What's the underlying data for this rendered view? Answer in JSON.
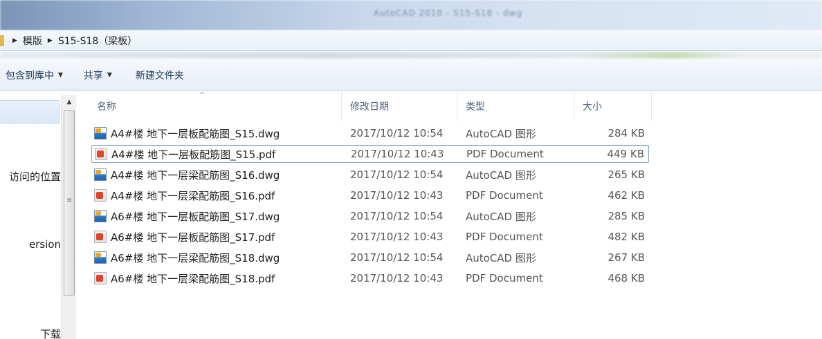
{
  "window": {
    "title_blurred": "AutoCAD 2010 - S15-S18 - dwg"
  },
  "address": {
    "crumbs": [
      "模版",
      "S15-S18（梁板）"
    ]
  },
  "toolbar": {
    "include_label": "包含到库中",
    "share_label": "共享",
    "new_folder_label": "新建文件夹"
  },
  "nav": {
    "items": [
      "访问的位置",
      "ersion",
      "下载"
    ]
  },
  "columns": {
    "name": "名称",
    "date": "修改日期",
    "type": "类型",
    "size": "大小"
  },
  "files": [
    {
      "name": "A4#楼 地下一层板配筋图_S15.dwg",
      "date": "2017/10/12 10:54",
      "type": "AutoCAD 图形",
      "size": "284 KB",
      "icon": "dwg-file-icon"
    },
    {
      "name": "A4#楼 地下一层板配筋图_S15.pdf",
      "date": "2017/10/12 10:43",
      "type": "PDF Document",
      "size": "449 KB",
      "icon": "pdf-file-icon"
    },
    {
      "name": "A4#楼 地下一层梁配筋图_S16.dwg",
      "date": "2017/10/12 10:54",
      "type": "AutoCAD 图形",
      "size": "265 KB",
      "icon": "dwg-file-icon"
    },
    {
      "name": "A4#楼 地下一层梁配筋图_S16.pdf",
      "date": "2017/10/12 10:43",
      "type": "PDF Document",
      "size": "462 KB",
      "icon": "pdf-file-icon"
    },
    {
      "name": "A6#楼 地下一层板配筋图_S17.dwg",
      "date": "2017/10/12 10:54",
      "type": "AutoCAD 图形",
      "size": "285 KB",
      "icon": "dwg-file-icon"
    },
    {
      "name": "A6#楼 地下一层板配筋图_S17.pdf",
      "date": "2017/10/12 10:43",
      "type": "PDF Document",
      "size": "482 KB",
      "icon": "pdf-file-icon"
    },
    {
      "name": "A6#楼 地下一层梁配筋图_S18.dwg",
      "date": "2017/10/12 10:54",
      "type": "AutoCAD 图形",
      "size": "267 KB",
      "icon": "dwg-file-icon"
    },
    {
      "name": "A6#楼 地下一层梁配筋图_S18.pdf",
      "date": "2017/10/12 10:43",
      "type": "PDF Document",
      "size": "468 KB",
      "icon": "pdf-file-icon"
    }
  ],
  "colors": {
    "selection_border": "#7da2ce",
    "header_text": "#4c607a",
    "toolbar_text": "#1e3a5f"
  }
}
